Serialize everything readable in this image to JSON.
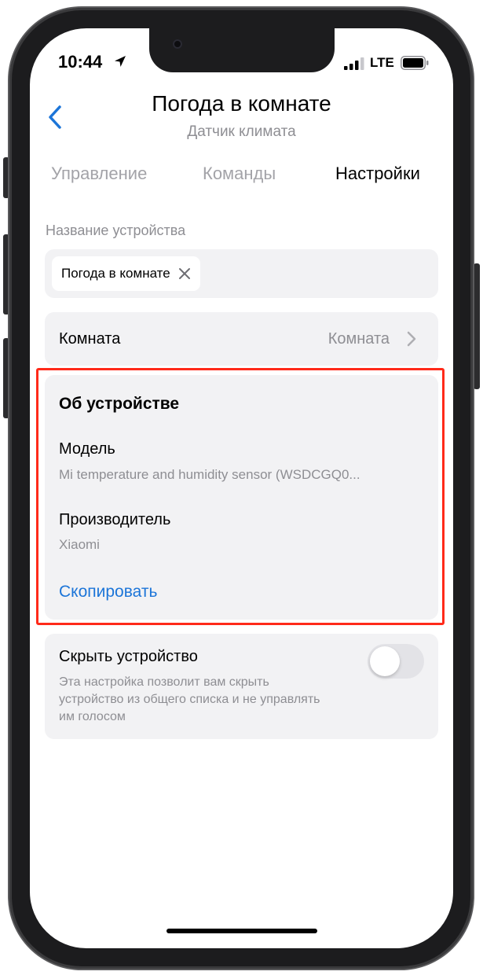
{
  "status_bar": {
    "time": "10:44",
    "network": "LTE",
    "icons": [
      "location-arrow-icon",
      "cellular-signal-icon",
      "battery-icon"
    ]
  },
  "header": {
    "title": "Погода в комнате",
    "subtitle": "Датчик климата",
    "back_icon": "chevron-left-icon"
  },
  "tabs": [
    {
      "label": "Управление",
      "active": false
    },
    {
      "label": "Команды",
      "active": false
    },
    {
      "label": "Настройки",
      "active": true
    }
  ],
  "device_name": {
    "label": "Название устройства",
    "value": "Погода в комнате",
    "clear_icon": "close-icon"
  },
  "room": {
    "label": "Комната",
    "value": "Комната",
    "chevron_icon": "chevron-right-icon"
  },
  "about": {
    "title": "Об устройстве",
    "model_label": "Модель",
    "model_value": "Mi temperature and humidity sensor (WSDCGQ0...",
    "vendor_label": "Производитель",
    "vendor_value": "Xiaomi",
    "copy_label": "Скопировать"
  },
  "hide_device": {
    "label": "Скрыть устройство",
    "description": "Эта настройка позволит вам скрыть устройство из общего списка и не управлять им голосом",
    "enabled": false
  },
  "colors": {
    "accent": "#1c75d8",
    "highlight": "#ff2a1a",
    "card_background": "#f2f2f4",
    "secondary_text": "#8e8e93"
  }
}
